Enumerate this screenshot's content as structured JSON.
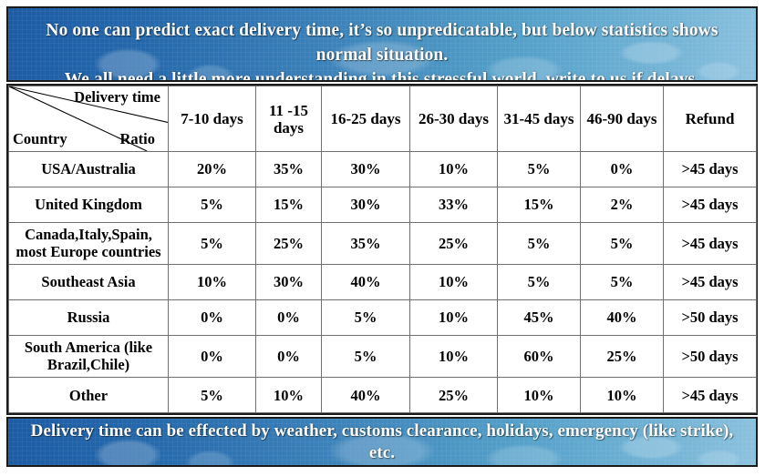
{
  "colors": {
    "banner_dark_blue": "#1d5ba4",
    "banner_light_blue": "#8cc2de",
    "banner_text": "#ffffff",
    "table_border": "#6f6f6f",
    "outer_border": "#1a1a1a",
    "table_background": "#ffffff",
    "text": "#000000"
  },
  "top_banner": {
    "line1": "No one can predict exact delivery time, it’s so unpredicatable, but below statistics shows normal situation.",
    "line2": "We all need a little more understanding in this stressful world, write to us if delays."
  },
  "bottom_banner": {
    "line1": "Delivery time can be effected by weather, customs clearance, holidays, emergency (like strike), etc."
  },
  "table": {
    "corner": {
      "top_right_label": "Delivery time",
      "middle_right_label": "Ratio",
      "bottom_left_label": "Country"
    },
    "columns": [
      "7-10 days",
      "11 -15 days",
      "16-25 days",
      "26-30 days",
      "31-45 days",
      "46-90 days",
      "Refund"
    ],
    "rows": [
      {
        "country": "USA/Australia",
        "values": [
          "20%",
          "35%",
          "30%",
          "10%",
          "5%",
          "0%"
        ],
        "refund": ">45 days"
      },
      {
        "country": "United Kingdom",
        "values": [
          "5%",
          "15%",
          "30%",
          "33%",
          "15%",
          "2%"
        ],
        "refund": ">45 days"
      },
      {
        "country": "Canada,Italy,Spain, most Europe countries",
        "country_line1": "Canada,Italy,Spain,",
        "country_line2": "most Europe countries",
        "values": [
          "5%",
          "25%",
          "35%",
          "25%",
          "5%",
          "5%"
        ],
        "refund": ">45 days"
      },
      {
        "country": "Southeast Asia",
        "values": [
          "10%",
          "30%",
          "40%",
          "10%",
          "5%",
          "5%"
        ],
        "refund": ">45 days"
      },
      {
        "country": "Russia",
        "values": [
          "0%",
          "0%",
          "5%",
          "10%",
          "45%",
          "40%"
        ],
        "refund": ">50 days"
      },
      {
        "country": "South America (like Brazil,Chile)",
        "country_line1": "South America (like",
        "country_line2": "Brazil,Chile)",
        "values": [
          "0%",
          "0%",
          "5%",
          "10%",
          "60%",
          "25%"
        ],
        "refund": ">50 days"
      },
      {
        "country": "Other",
        "values": [
          "5%",
          "10%",
          "40%",
          "25%",
          "10%",
          "10%"
        ],
        "refund": ">45 days"
      }
    ]
  }
}
